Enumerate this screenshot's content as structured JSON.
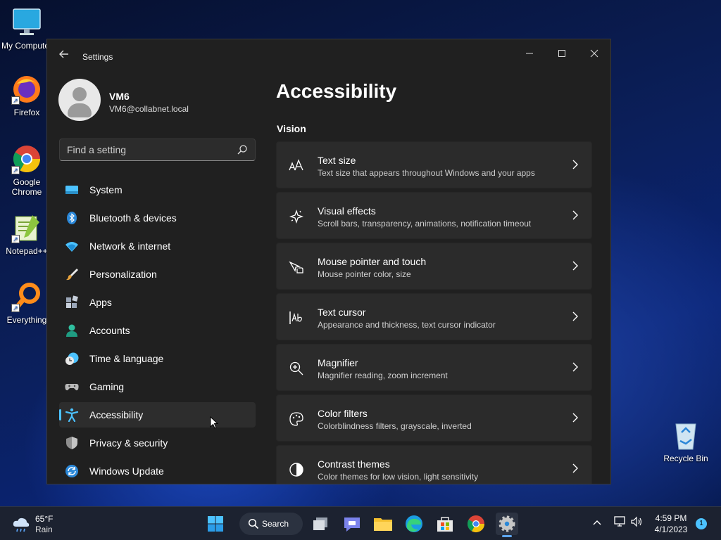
{
  "desktop": {
    "icons": [
      {
        "label": "My Computer"
      },
      {
        "label": "Firefox"
      },
      {
        "label": "Google Chrome"
      },
      {
        "label": "Notepad++"
      },
      {
        "label": "Everything"
      },
      {
        "label": "Recycle Bin"
      }
    ]
  },
  "window": {
    "title": "Settings",
    "controls": {
      "minimize": "minimize",
      "maximize": "maximize",
      "close": "close"
    }
  },
  "profile": {
    "name": "VM6",
    "email": "VM6@collabnet.local"
  },
  "search": {
    "placeholder": "Find a setting"
  },
  "nav": {
    "items": [
      {
        "label": "System",
        "icon": "system-icon",
        "color": "#4cc2ff"
      },
      {
        "label": "Bluetooth & devices",
        "icon": "bluetooth-icon",
        "color": "#2b88d8"
      },
      {
        "label": "Network & internet",
        "icon": "wifi-icon",
        "color": "#4cc2ff"
      },
      {
        "label": "Personalization",
        "icon": "brush-icon",
        "color": "#e8a33d"
      },
      {
        "label": "Apps",
        "icon": "apps-icon",
        "color": "#9aa6b8"
      },
      {
        "label": "Accounts",
        "icon": "accounts-icon",
        "color": "#2fbf9f"
      },
      {
        "label": "Time & language",
        "icon": "clock-globe-icon",
        "color": "#4cc2ff"
      },
      {
        "label": "Gaming",
        "icon": "gamepad-icon",
        "color": "#b8b8b8"
      },
      {
        "label": "Accessibility",
        "icon": "accessibility-icon",
        "color": "#4cc2ff"
      },
      {
        "label": "Privacy & security",
        "icon": "shield-icon",
        "color": "#a0a0a0"
      },
      {
        "label": "Windows Update",
        "icon": "update-icon",
        "color": "#2b88d8"
      }
    ],
    "active": "Accessibility"
  },
  "main": {
    "title": "Accessibility",
    "section": "Vision",
    "cards": [
      {
        "title": "Text size",
        "subtitle": "Text size that appears throughout Windows and your apps",
        "icon": "text-size-icon"
      },
      {
        "title": "Visual effects",
        "subtitle": "Scroll bars, transparency, animations, notification timeout",
        "icon": "sparkle-icon"
      },
      {
        "title": "Mouse pointer and touch",
        "subtitle": "Mouse pointer color, size",
        "icon": "pointer-touch-icon"
      },
      {
        "title": "Text cursor",
        "subtitle": "Appearance and thickness, text cursor indicator",
        "icon": "text-cursor-icon"
      },
      {
        "title": "Magnifier",
        "subtitle": "Magnifier reading, zoom increment",
        "icon": "magnifier-icon"
      },
      {
        "title": "Color filters",
        "subtitle": "Colorblindness filters, grayscale, inverted",
        "icon": "palette-icon"
      },
      {
        "title": "Contrast themes",
        "subtitle": "Color themes for low vision, light sensitivity",
        "icon": "contrast-icon"
      }
    ]
  },
  "taskbar": {
    "weather": {
      "temp": "65°F",
      "condition": "Rain"
    },
    "search_label": "Search",
    "clock": {
      "time": "4:59 PM",
      "date": "4/1/2023"
    },
    "notification_count": "1"
  },
  "colors": {
    "accent": "#4cc2ff",
    "window_bg": "#202020",
    "card_bg": "#2b2b2b"
  }
}
